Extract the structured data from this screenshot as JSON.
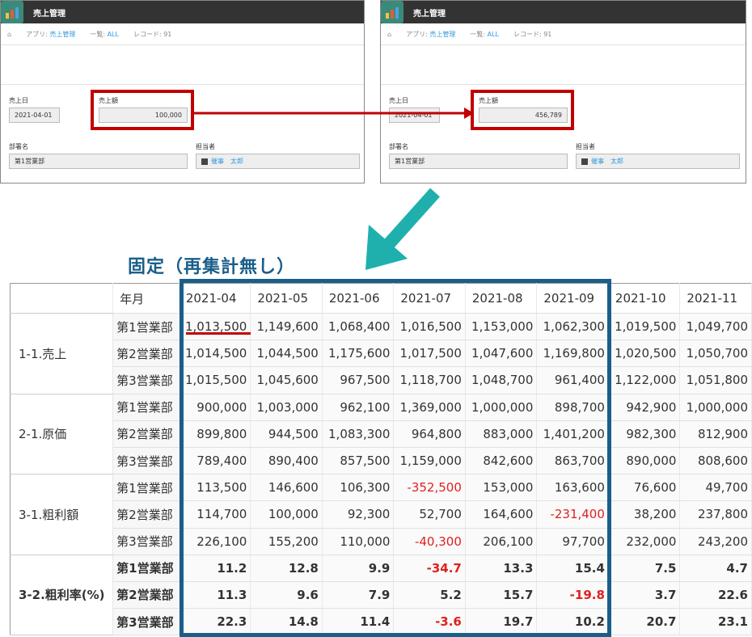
{
  "panels": [
    {
      "app_title": "売上管理",
      "home": "home-icon",
      "crumb_app_label": "アプリ: ",
      "crumb_app": "売上管理",
      "crumb_list_label": "一覧: ",
      "crumb_list": "ALL",
      "crumb_record": "レコード: 91",
      "fields": {
        "date_label": "売上日",
        "date": "2021-04-01",
        "amount_label": "売上額",
        "amount": "100,000",
        "dept_label": "部署名",
        "dept": "第1営業部",
        "owner_label": "担当者",
        "owner": "催事　太郎"
      }
    },
    {
      "app_title": "売上管理",
      "home": "home-icon",
      "crumb_app_label": "アプリ: ",
      "crumb_app": "売上管理",
      "crumb_list_label": "一覧: ",
      "crumb_list": "ALL",
      "crumb_record": "レコード: 91",
      "fields": {
        "date_label": "売上日",
        "date": "2021-04-01",
        "amount_label": "売上額",
        "amount": "456,789",
        "dept_label": "部署名",
        "dept": "第1営業部",
        "owner_label": "担当者",
        "owner": "催事　太郎"
      }
    }
  ],
  "caption": "固定（再集計無し）",
  "table": {
    "corner": "年月",
    "months": [
      "2021-04",
      "2021-05",
      "2021-06",
      "2021-07",
      "2021-08",
      "2021-09",
      "2021-10",
      "2021-11"
    ],
    "groups": [
      {
        "label": "1-1.売上",
        "bold": false,
        "rows": [
          {
            "dept": "第1営業部",
            "values": [
              "1,013,500",
              "1,149,600",
              "1,068,400",
              "1,016,500",
              "1,153,000",
              "1,062,300",
              "1,019,500",
              "1,049,700"
            ]
          },
          {
            "dept": "第2営業部",
            "values": [
              "1,014,500",
              "1,044,500",
              "1,175,600",
              "1,017,500",
              "1,047,600",
              "1,169,800",
              "1,020,500",
              "1,050,700"
            ]
          },
          {
            "dept": "第3営業部",
            "values": [
              "1,015,500",
              "1,045,600",
              "967,500",
              "1,118,700",
              "1,048,700",
              "961,400",
              "1,122,000",
              "1,051,800"
            ]
          }
        ]
      },
      {
        "label": "2-1.原価",
        "bold": false,
        "rows": [
          {
            "dept": "第1営業部",
            "values": [
              "900,000",
              "1,003,000",
              "962,100",
              "1,369,000",
              "1,000,000",
              "898,700",
              "942,900",
              "1,000,000"
            ]
          },
          {
            "dept": "第2営業部",
            "values": [
              "899,800",
              "944,500",
              "1,083,300",
              "964,800",
              "883,000",
              "1,401,200",
              "982,300",
              "812,900"
            ]
          },
          {
            "dept": "第3営業部",
            "values": [
              "789,400",
              "890,400",
              "857,500",
              "1,159,000",
              "842,600",
              "863,700",
              "890,000",
              "808,600"
            ]
          }
        ]
      },
      {
        "label": "3-1.粗利額",
        "bold": false,
        "rows": [
          {
            "dept": "第1営業部",
            "values": [
              "113,500",
              "146,600",
              "106,300",
              "-352,500",
              "153,000",
              "163,600",
              "76,600",
              "49,700"
            ]
          },
          {
            "dept": "第2営業部",
            "values": [
              "114,700",
              "100,000",
              "92,300",
              "52,700",
              "164,600",
              "-231,400",
              "38,200",
              "237,800"
            ]
          },
          {
            "dept": "第3営業部",
            "values": [
              "226,100",
              "155,200",
              "110,000",
              "-40,300",
              "206,100",
              "97,700",
              "232,000",
              "243,200"
            ]
          }
        ]
      },
      {
        "label": "3-2.粗利率(%)",
        "bold": true,
        "rows": [
          {
            "dept": "第1営業部",
            "values": [
              "11.2",
              "12.8",
              "9.9",
              "-34.7",
              "13.3",
              "15.4",
              "7.5",
              "4.7"
            ]
          },
          {
            "dept": "第2営業部",
            "values": [
              "11.3",
              "9.6",
              "7.9",
              "5.2",
              "15.7",
              "-19.8",
              "3.7",
              "22.6"
            ]
          },
          {
            "dept": "第3営業部",
            "values": [
              "22.3",
              "14.8",
              "11.4",
              "-3.6",
              "19.7",
              "10.2",
              "20.7",
              "23.1"
            ]
          }
        ]
      }
    ]
  },
  "colors": {
    "highlight_red": "#c00000",
    "frame_blue": "#1a5e8a",
    "arrow_teal": "#1fb0ad",
    "negative": "#e02020"
  }
}
